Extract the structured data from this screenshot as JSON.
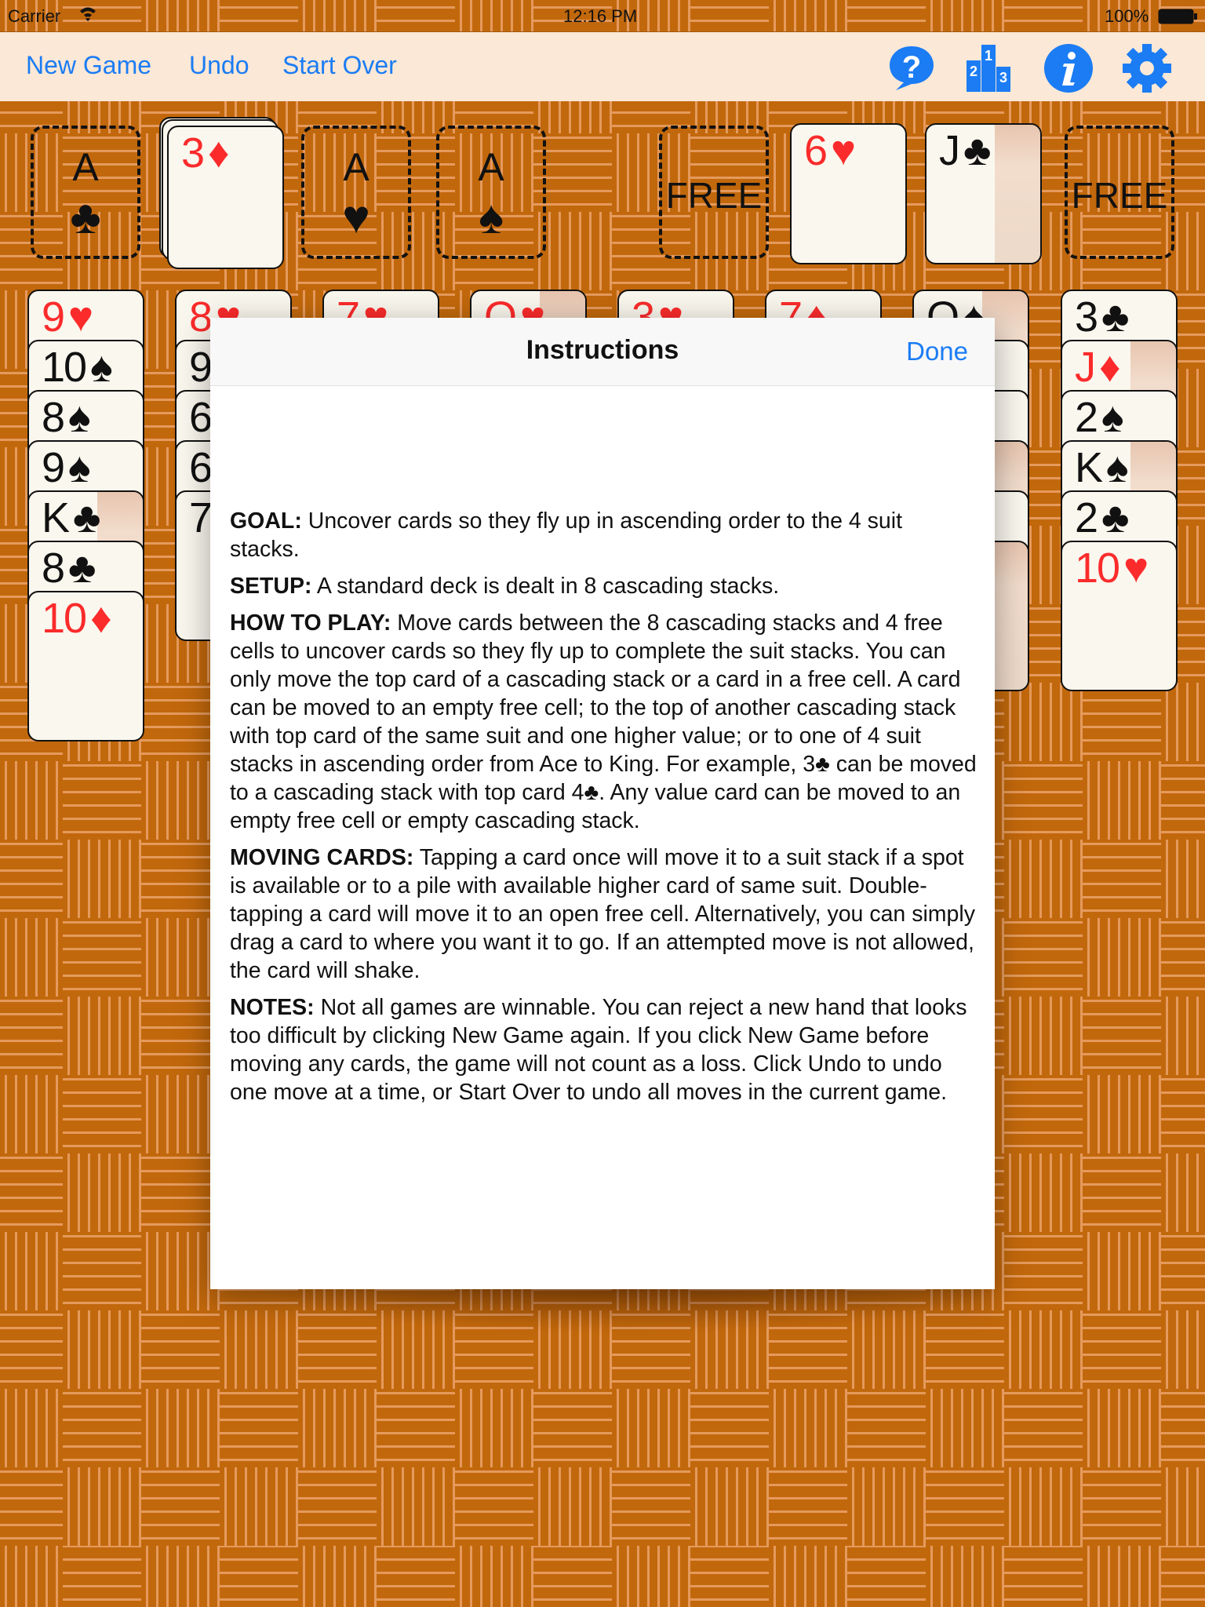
{
  "status_bar": {
    "carrier": "Carrier",
    "time": "12:16 PM",
    "battery": "100%"
  },
  "toolbar": {
    "new_game": "New Game",
    "undo": "Undo",
    "start_over": "Start Over",
    "icons": [
      "help-bubble-icon",
      "leaderboard-podium-icon",
      "info-icon",
      "gear-icon"
    ],
    "accent": "#1b7cf4"
  },
  "foundations": [
    {
      "placeholder_rank": "A",
      "placeholder_suit": "♣",
      "card": null
    },
    {
      "placeholder_rank": null,
      "card": {
        "rank": "3",
        "suit": "♦"
      }
    },
    {
      "placeholder_rank": "A",
      "placeholder_suit": "♥",
      "card": null
    },
    {
      "placeholder_rank": "A",
      "placeholder_suit": "♠",
      "card": null
    }
  ],
  "free_cells": [
    {
      "label": "FREE",
      "card": null
    },
    {
      "label": null,
      "card": {
        "rank": "6",
        "suit": "♥"
      }
    },
    {
      "label": null,
      "card": {
        "rank": "J",
        "suit": "♣",
        "face": true
      }
    },
    {
      "label": "FREE",
      "card": null
    }
  ],
  "cascades": [
    [
      {
        "rank": "9",
        "suit": "♥"
      },
      {
        "rank": "10",
        "suit": "♠"
      },
      {
        "rank": "8",
        "suit": "♠"
      },
      {
        "rank": "9",
        "suit": "♠"
      },
      {
        "rank": "K",
        "suit": "♣",
        "face": true
      },
      {
        "rank": "8",
        "suit": "♣"
      },
      {
        "rank": "10",
        "suit": "♦"
      }
    ],
    [
      {
        "rank": "8",
        "suit": "♥"
      },
      {
        "rank": "9",
        "suit": ""
      },
      {
        "rank": "6",
        "suit": ""
      },
      {
        "rank": "6",
        "suit": ""
      },
      {
        "rank": "7",
        "suit": ""
      }
    ],
    [
      {
        "rank": "7",
        "suit": "♥"
      }
    ],
    [
      {
        "rank": "Q",
        "suit": "♥",
        "face": true
      }
    ],
    [
      {
        "rank": "3",
        "suit": "♥"
      }
    ],
    [
      {
        "rank": "7",
        "suit": "♦"
      }
    ],
    [
      {
        "rank": "Q",
        "suit": "♠",
        "face": true
      },
      {
        "rank": "",
        "suit": "♠"
      },
      {
        "rank": "",
        "suit": "♥"
      },
      {
        "rank": "",
        "suit": "♠",
        "face": true
      },
      {
        "rank": "",
        "suit": "♠"
      },
      {
        "rank": "",
        "suit": "♦",
        "face": true
      }
    ],
    [
      {
        "rank": "3",
        "suit": "♣"
      },
      {
        "rank": "J",
        "suit": "♦",
        "face": true
      },
      {
        "rank": "2",
        "suit": "♠"
      },
      {
        "rank": "K",
        "suit": "♠",
        "face": true
      },
      {
        "rank": "2",
        "suit": "♣"
      },
      {
        "rank": "10",
        "suit": "♥"
      }
    ]
  ],
  "modal": {
    "title": "Instructions",
    "done": "Done",
    "sections": [
      {
        "heading": "GOAL:",
        "text": " Uncover cards so they fly up in ascending order to the 4 suit stacks."
      },
      {
        "heading": "SETUP:",
        "text": " A standard deck is dealt in 8 cascading stacks."
      },
      {
        "heading": "HOW TO PLAY:",
        "text": " Move cards between the 8 cascading stacks and 4 free cells to uncover cards so they fly up to complete the suit stacks. You can only move the top card of a cascading stack or a card in a free cell. A card can be moved to an empty free cell; to the top of another cascading stack with top card of the same suit and one higher value; or to one of 4 suit stacks in ascending order from Ace to King. For example, 3♣ can be moved to a cascading stack with top card 4♣. Any value card can be moved to an empty free cell or empty cascading stack."
      },
      {
        "heading": "MOVING CARDS:",
        "text": " Tapping a card once will move it to a suit stack if a spot is available or to a pile with available higher card of same suit. Double-tapping a card will move it to an open free cell. Alternatively, you can simply drag a card to where you want it to go. If an attempted move is not allowed, the card will shake."
      },
      {
        "heading": "NOTES:",
        "text": " Not all games are winnable. You can reject a new hand that looks too difficult by clicking New Game again. If you click New Game before moving any cards, the game will not count as a loss. Click Undo to undo one move at a time, or Start Over to undo all moves in the current game."
      }
    ]
  },
  "colors": {
    "felt": "#c2680c",
    "toolbar_bg": "#fbe8d6",
    "red_suit": "#fb2b2b",
    "card_bg": "#faf7ee"
  }
}
